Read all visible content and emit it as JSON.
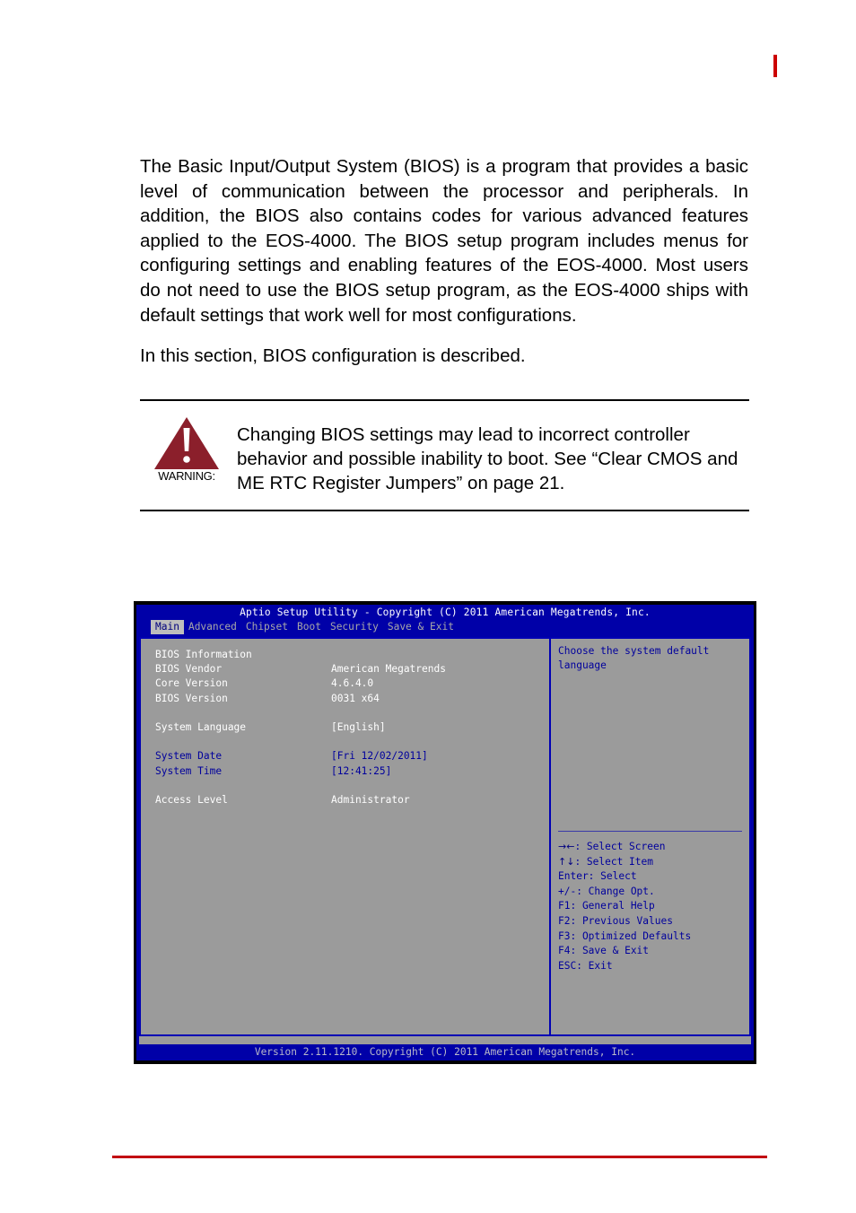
{
  "document": {
    "paragraphs": [
      "The Basic Input/Output System (BIOS) is a program that provides a basic level of communication between the processor and peripherals. In addition, the BIOS also contains codes for various advanced features applied to the EOS-4000. The BIOS setup program includes menus for configuring settings and enabling features of the EOS-4000. Most users do not need to use the BIOS setup program, as the EOS-4000 ships with default settings that work well for most configurations.",
      "In this section, BIOS configuration is described."
    ],
    "warning": {
      "label": "WARNING:",
      "icon": "warning-triangle-icon",
      "text": "Changing BIOS settings may lead to incorrect controller behavior and possible inability to boot. See “Clear CMOS and ME RTC Register Jumpers” on page 21.",
      "accent_color": "#8b1f2b"
    },
    "page_marker_color": "#cc0000",
    "footer_rule_color": "#c20012"
  },
  "bios": {
    "title": "Aptio Setup Utility - Copyright (C) 2011 American Megatrends, Inc.",
    "tabs": [
      {
        "label": "Main",
        "active": true
      },
      {
        "label": "Advanced",
        "active": false
      },
      {
        "label": "Chipset",
        "active": false
      },
      {
        "label": "Boot",
        "active": false
      },
      {
        "label": "Security",
        "active": false
      },
      {
        "label": "Save & Exit",
        "active": false
      }
    ],
    "rows": [
      {
        "label": "BIOS Information",
        "value": "",
        "heading": true,
        "highlight": false
      },
      {
        "label": "BIOS Vendor",
        "value": "American Megatrends",
        "heading": false,
        "highlight": false
      },
      {
        "label": "Core Version",
        "value": "4.6.4.0",
        "heading": false,
        "highlight": false
      },
      {
        "label": "BIOS Version",
        "value": "0031 x64",
        "heading": false,
        "highlight": false
      },
      {
        "label": "",
        "value": "",
        "gap": true
      },
      {
        "label": "System Language",
        "value": "[English]",
        "heading": false,
        "highlight": false
      },
      {
        "label": "",
        "value": "",
        "gap": true
      },
      {
        "label": "System Date",
        "value": "[Fri 12/02/2011]",
        "heading": false,
        "highlight": true
      },
      {
        "label": "System Time",
        "value": "[12:41:25]",
        "heading": false,
        "highlight": true
      },
      {
        "label": "",
        "value": "",
        "gap": true
      },
      {
        "label": "Access Level",
        "value": "Administrator",
        "heading": false,
        "highlight": false
      }
    ],
    "help": {
      "description": "Choose the system default language",
      "keys": [
        {
          "glyph": "→←",
          "text": ": Select Screen"
        },
        {
          "glyph": "↑↓",
          "text": ": Select Item"
        },
        {
          "glyph": "",
          "text": "Enter: Select"
        },
        {
          "glyph": "",
          "text": "+/-: Change Opt."
        },
        {
          "glyph": "",
          "text": "F1: General Help"
        },
        {
          "glyph": "",
          "text": "F2: Previous Values"
        },
        {
          "glyph": "",
          "text": "F3: Optimized Defaults"
        },
        {
          "glyph": "",
          "text": "F4: Save & Exit"
        },
        {
          "glyph": "",
          "text": "ESC: Exit"
        }
      ]
    },
    "footer": "Version 2.11.1210. Copyright (C) 2011 American Megatrends, Inc.",
    "colors": {
      "chrome_blue": "#0000a8",
      "panel_gray": "#9b9b9b",
      "highlight_blue": "#00009c",
      "tab_active_bg": "#bdbdbd"
    }
  }
}
